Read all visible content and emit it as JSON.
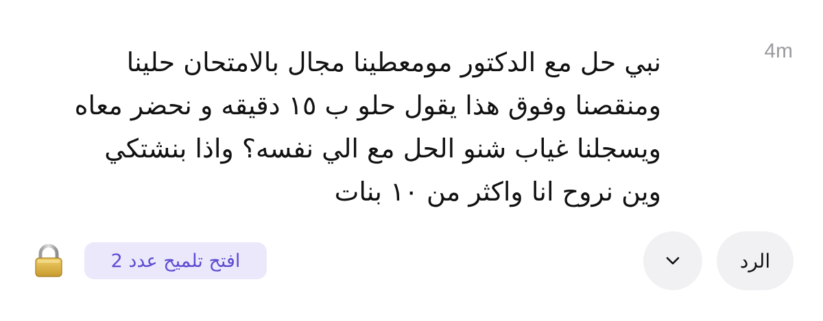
{
  "post": {
    "timestamp": "4m",
    "lines": [
      "نبي حل مع الدكتور مومعطينا مجال بالامتحان حلينا",
      "ومنقصنا وفوق هذا يقول حلو ب ١٥ دقيقه و نحضر معاه",
      "ويسجلنا غياب شنو الحل مع الي نفسه؟ واذا بنشتكي",
      "وين نروح انا واكثر من ١٠ بنات"
    ]
  },
  "actions": {
    "reply_label": "الرد",
    "expand_icon": "chevron-down-icon",
    "hint_label": "افتح تلميح عدد 2",
    "lock_icon": "lock-icon"
  },
  "colors": {
    "hint_bg": "#ece8fb",
    "hint_text": "#5b4bd1",
    "button_bg": "#f1f1f3",
    "timestamp": "#9a9aa0",
    "lock_body": "#d9b34a"
  }
}
